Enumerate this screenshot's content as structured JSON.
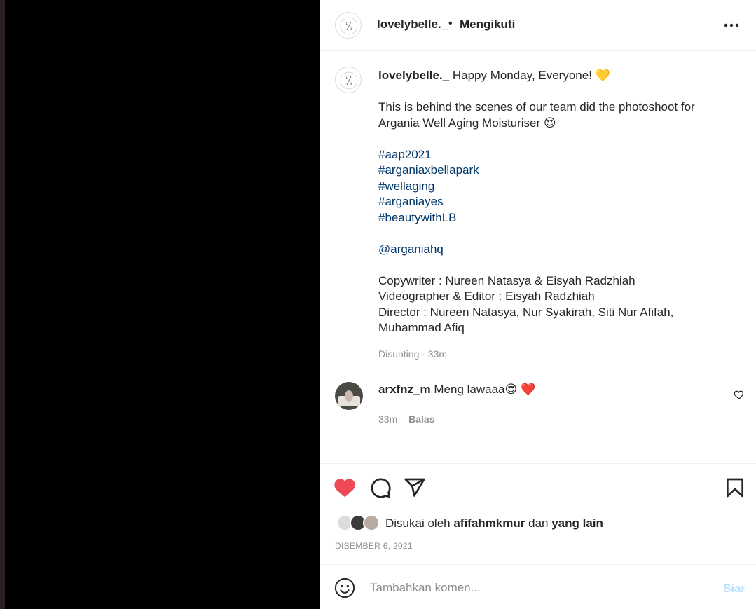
{
  "header": {
    "username": "lovelybelle._",
    "separator": "•",
    "follow_status": "Mengikuti"
  },
  "caption": {
    "username": "lovelybelle._",
    "line1": "Happy Monday, Everyone! 💛",
    "line2": "This is behind the scenes of our team did the photoshoot for Argania Well Aging Moisturiser 😍",
    "hashtags": [
      "#aap2021",
      "#arganiaxbellapark",
      "#wellaging",
      "#arganiayes",
      "#beautywithLB"
    ],
    "mention": "@arganiahq",
    "credits": [
      "Copywriter : Nureen Natasya & Eisyah Radzhiah",
      "Videographer & Editor : Eisyah Radzhiah",
      "Director : Nureen Natasya, Nur Syakirah, Siti Nur Afifah, Muhammad Afiq"
    ],
    "meta": "Disunting · 33m"
  },
  "comment": {
    "username": "arxfnz_m",
    "text": "Meng lawaaa😍 ❤️",
    "time": "33m",
    "reply_label": "Balas"
  },
  "likes": {
    "prefix": "Disukai oleh",
    "user": "afifahmkmur",
    "middle": "dan",
    "others": "yang lain"
  },
  "date": "DISEMBER 6, 2021",
  "add_comment": {
    "placeholder": "Tambahkan komen...",
    "post_label": "Siar"
  },
  "colors": {
    "like_active": "#ed4956",
    "link": "#00376b",
    "muted": "#8e8e8e",
    "post_disabled": "#b2dffc"
  },
  "icons": {
    "more": "more-horizontal-icon",
    "like": "heart-filled-icon",
    "comment": "comment-bubble-icon",
    "share": "paper-plane-icon",
    "save": "bookmark-icon",
    "emoji": "smiley-icon",
    "comment_like": "heart-outline-icon"
  }
}
